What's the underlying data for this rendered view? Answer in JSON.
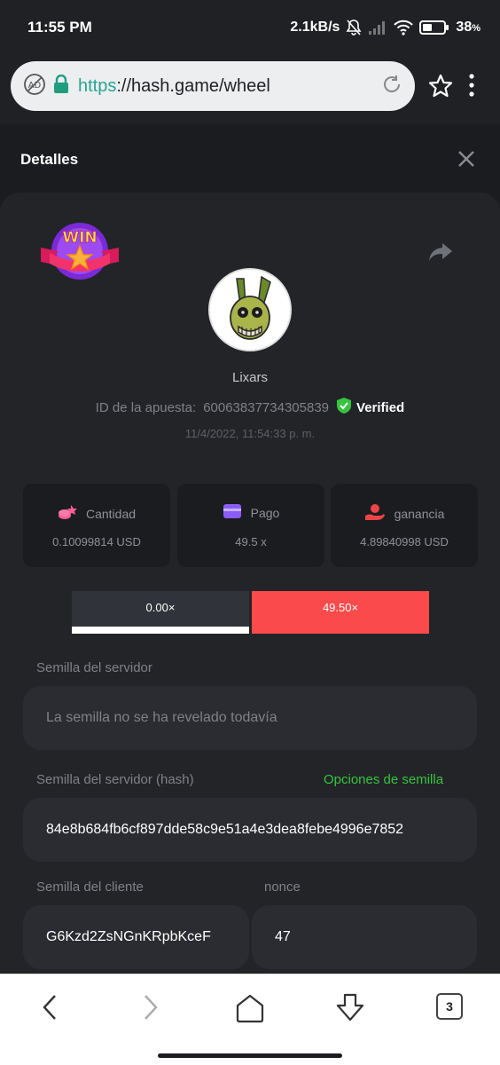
{
  "status_bar": {
    "time": "11:55 PM",
    "network_speed": "2.1kB/s",
    "battery": "38",
    "battery_unit": "%",
    "icons": [
      "mute-bell-icon",
      "signal-icon",
      "wifi-icon",
      "battery-icon"
    ]
  },
  "browser": {
    "url_scheme": "https",
    "url_rest": "://hash.game/wheel",
    "icons": [
      "adblock-icon",
      "lock-icon",
      "reload-icon",
      "star-icon",
      "overflow-menu-icon"
    ]
  },
  "panel": {
    "title": "Detalles"
  },
  "bet": {
    "badge": "WIN",
    "username": "Lixars",
    "id_label": "ID de la apuesta:",
    "id_value": "60063837734305839",
    "verified_label": "Verified",
    "timestamp": "11/4/2022, 11:54:33 p. m."
  },
  "stats": [
    {
      "label": "Cantidad",
      "value": "0.10099814 USD",
      "icon": "coins-icon",
      "color": "#ff5d93"
    },
    {
      "label": "Pago",
      "value": "49.5 x",
      "icon": "wallet-icon",
      "color": "#8b5cf6"
    },
    {
      "label": "ganancia",
      "value": "4.89840998 USD",
      "icon": "money-hand-icon",
      "color": "#ef4444"
    }
  ],
  "multipliers": {
    "low": "0.00×",
    "high": "49.50×"
  },
  "fields": {
    "server_seed_label": "Semilla del servidor",
    "server_seed_value": "La semilla no se ha revelado todavía",
    "server_hash_label": "Semilla del servidor (hash)",
    "seed_options": "Opciones de semilla",
    "server_hash_value": "84e8b684fb6cf897dde58c9e51a4e3dea8febe4996e7852",
    "client_seed_label": "Semilla del cliente",
    "client_seed_value": "G6Kzd2ZsNGnKRpbKceF",
    "nonce_label": "nonce",
    "nonce_value": "47"
  },
  "bottom_nav": {
    "tabs_count": "3",
    "icons": [
      "back-icon",
      "forward-icon",
      "home-icon",
      "download-icon",
      "tabs-icon"
    ]
  },
  "colors": {
    "accent_red": "#fa4a4b",
    "accent_green": "#36c43f",
    "url_teal": "#2aa392"
  }
}
